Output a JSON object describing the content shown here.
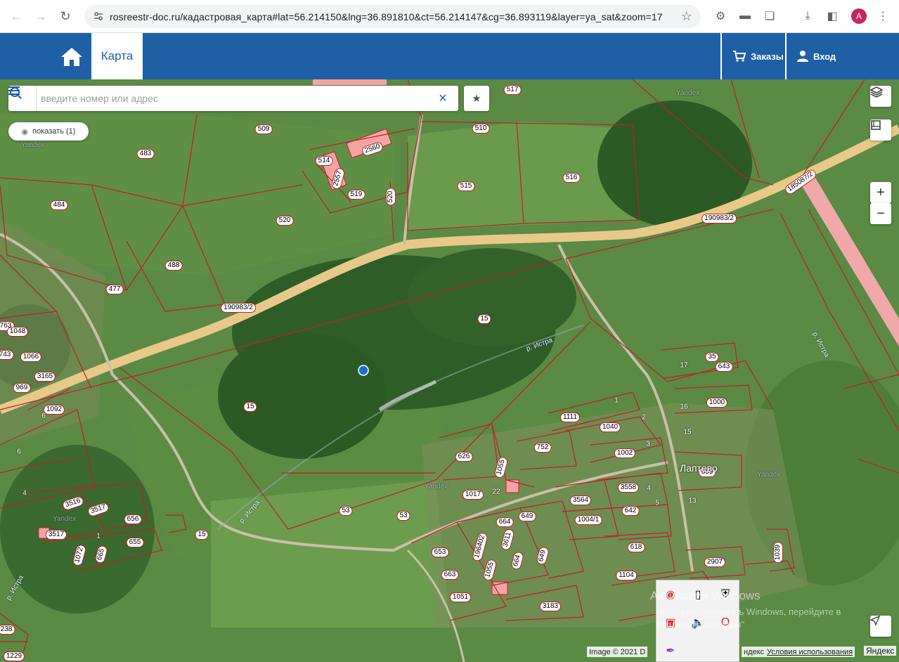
{
  "browser": {
    "url": "rosreestr-doc.ru/кадастровая_карта#lat=56.214150&lng=36.891810&ct=56.214147&cg=36.893119&layer=ya_sat&zoom=17",
    "avatar_letter": "A"
  },
  "header": {
    "tab_map": "Карта",
    "orders": "Заказы",
    "login": "Вход"
  },
  "search": {
    "placeholder": "введите номер или адрес"
  },
  "show_button": "показать (1)",
  "map": {
    "plots": [
      "517",
      "509",
      "483",
      "510",
      "2560",
      "514",
      "2557",
      "519",
      "520",
      "516",
      "515",
      "484",
      "520",
      "190983/2",
      "185087/2",
      "488",
      "477",
      "190983/2",
      "15",
      "1066",
      "763",
      "1048",
      "743",
      "969",
      "3165",
      "1092",
      "15",
      "17",
      "35",
      "643",
      "16",
      "1000",
      "1",
      "1111",
      "2",
      "1040",
      "626",
      "752",
      "3",
      "1002",
      "1055",
      "659",
      "3558",
      "4",
      "22",
      "1017",
      "3564",
      "5",
      "1004/1",
      "642",
      "649",
      "664",
      "618",
      "53",
      "53",
      "3516",
      "3517",
      "656",
      "655",
      "3517",
      "665",
      "1072",
      "15",
      "653",
      "196402",
      "3611",
      "649",
      "664",
      "1055",
      "2907",
      "1039",
      "663",
      "1104",
      "1051",
      "3183",
      "238",
      "1229"
    ],
    "house_numbers": [
      "6",
      "6",
      "4",
      "1",
      "15",
      "13"
    ],
    "river_labels": [
      "р. Истра",
      "р. Истра",
      "р. Истра",
      "р. Истра"
    ],
    "yandex_labels": [
      "Yandex",
      "Yandex",
      "Yandex",
      "Yandex",
      "Yandex"
    ],
    "village": "Лаптево",
    "attribution_left": "Image © 2021 D",
    "attribution_right": "ндекс",
    "terms": "Условия использования",
    "yandex_logo": "Яндекс",
    "windows_watermark_title": "Активация Windows",
    "windows_watermark_sub": "Чтобы активировать Windows, перейдите в",
    "windows_watermark_sub2": "раздел \"Параметры\""
  }
}
